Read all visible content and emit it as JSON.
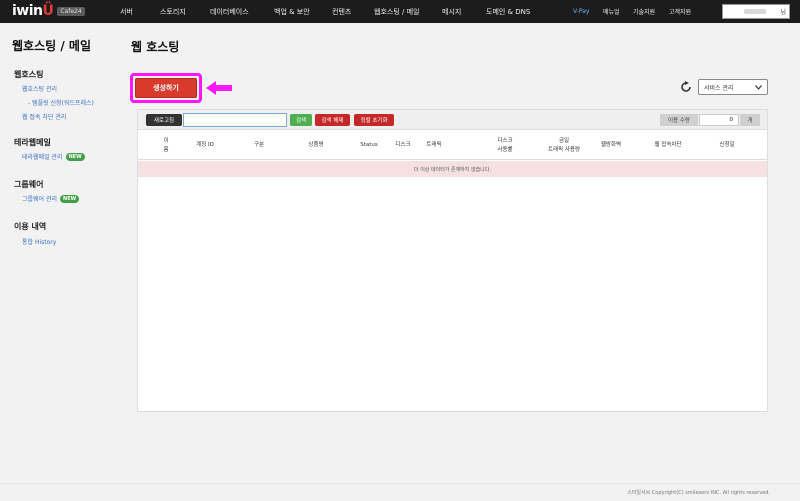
{
  "header": {
    "logo_text": "iwin",
    "logo_badge": "Cafe24",
    "nav": [
      "서버",
      "스토리지",
      "데이터베이스",
      "백업 & 보안",
      "컨텐츠",
      "웹호스팅 / 메일",
      "메시지",
      "도메인 & DNS"
    ],
    "vpay": "V-Pay",
    "manual": "메뉴얼",
    "tech_support": "기술지원",
    "customer_support": "고객지원",
    "user_suffix": "님"
  },
  "sidebar": {
    "title": "웹호스팅 / 메일",
    "sections": [
      {
        "heading": "웹호스팅",
        "links": [
          "웹호스팅 관리",
          "- 템플릿 신청(워드프레스)",
          "웹 접속 차단 관리"
        ]
      },
      {
        "heading": "테라웹메일",
        "links": [
          "테라웹메일 관리"
        ],
        "badge": "NEW"
      },
      {
        "heading": "그룹웨어",
        "links": [
          "그룹웨어 관리"
        ],
        "badge": "NEW"
      },
      {
        "heading": "이용 내역",
        "links": [
          "통합 History"
        ]
      }
    ]
  },
  "main": {
    "title": "웹 호스팅",
    "create_button": "생성하기",
    "service_select": "서비스 관리",
    "toolbar": {
      "refresh": "새로고침",
      "search_value": "",
      "search": "검색",
      "search_clear": "검색 해제",
      "sort_reset": "정렬 초기화",
      "qty_label": "이용 수량",
      "qty_value": "0",
      "qty_unit": "개"
    },
    "columns": [
      [
        "이",
        "름"
      ],
      [
        "계정 ID"
      ],
      [
        "구분"
      ],
      [
        "상품명"
      ],
      [
        "Status"
      ],
      [
        "디스크"
      ],
      [
        "트래픽"
      ],
      [
        "디스크",
        "사용률"
      ],
      [
        "금일",
        "트래픽 사용량"
      ],
      [
        "웹방화벽"
      ],
      [
        "웹 접속차단"
      ],
      [
        "신청일"
      ]
    ],
    "empty_message": "더 이상 데이터가 존재하지 않습니다."
  },
  "footer": {
    "copyright": "스마일서브 Copyright(C) smileserv INC. All rights reserved."
  },
  "colors": {
    "highlight": "#ff16ff",
    "create_button": "#d83a2c",
    "topbar": "#1c1c1c"
  }
}
